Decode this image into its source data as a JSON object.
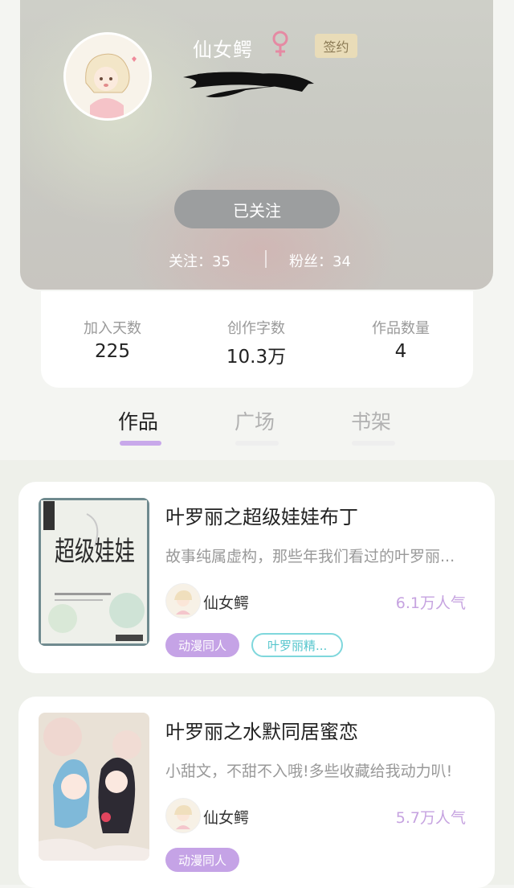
{
  "profile": {
    "name": "仙女鳄",
    "gender_icon": "female-icon",
    "badge": "签约",
    "follow_button": "已关注",
    "following": "关注：35",
    "fans": "粉丝：34"
  },
  "stats": [
    {
      "label": "加入天数",
      "value": "225"
    },
    {
      "label": "创作字数",
      "value": "10.3万"
    },
    {
      "label": "作品数量",
      "value": "4"
    }
  ],
  "tabs": [
    {
      "label": "作品",
      "active": true
    },
    {
      "label": "广场",
      "active": false
    },
    {
      "label": "书架",
      "active": false
    }
  ],
  "books": [
    {
      "title": "叶罗丽之超级娃娃布丁",
      "description": "故事纯属虚构，那些年我们看过的叶罗丽...",
      "author": "仙女鳄",
      "popularity": "6.1万人气",
      "tags": [
        "动漫同人",
        "叶罗丽精..."
      ],
      "cover_text": "超级娃娃"
    },
    {
      "title": "叶罗丽之水默同居蜜恋",
      "description": "小甜文，不甜不入哦!多些收藏给我动力叭!",
      "author": "仙女鳄",
      "popularity": "5.7万人气",
      "tags": [
        "动漫同人"
      ]
    }
  ],
  "colors": {
    "accent_purple": "#c5a3e6",
    "tag_cyan": "#7fd7dc",
    "badge_gold": "#e9dcb8"
  }
}
